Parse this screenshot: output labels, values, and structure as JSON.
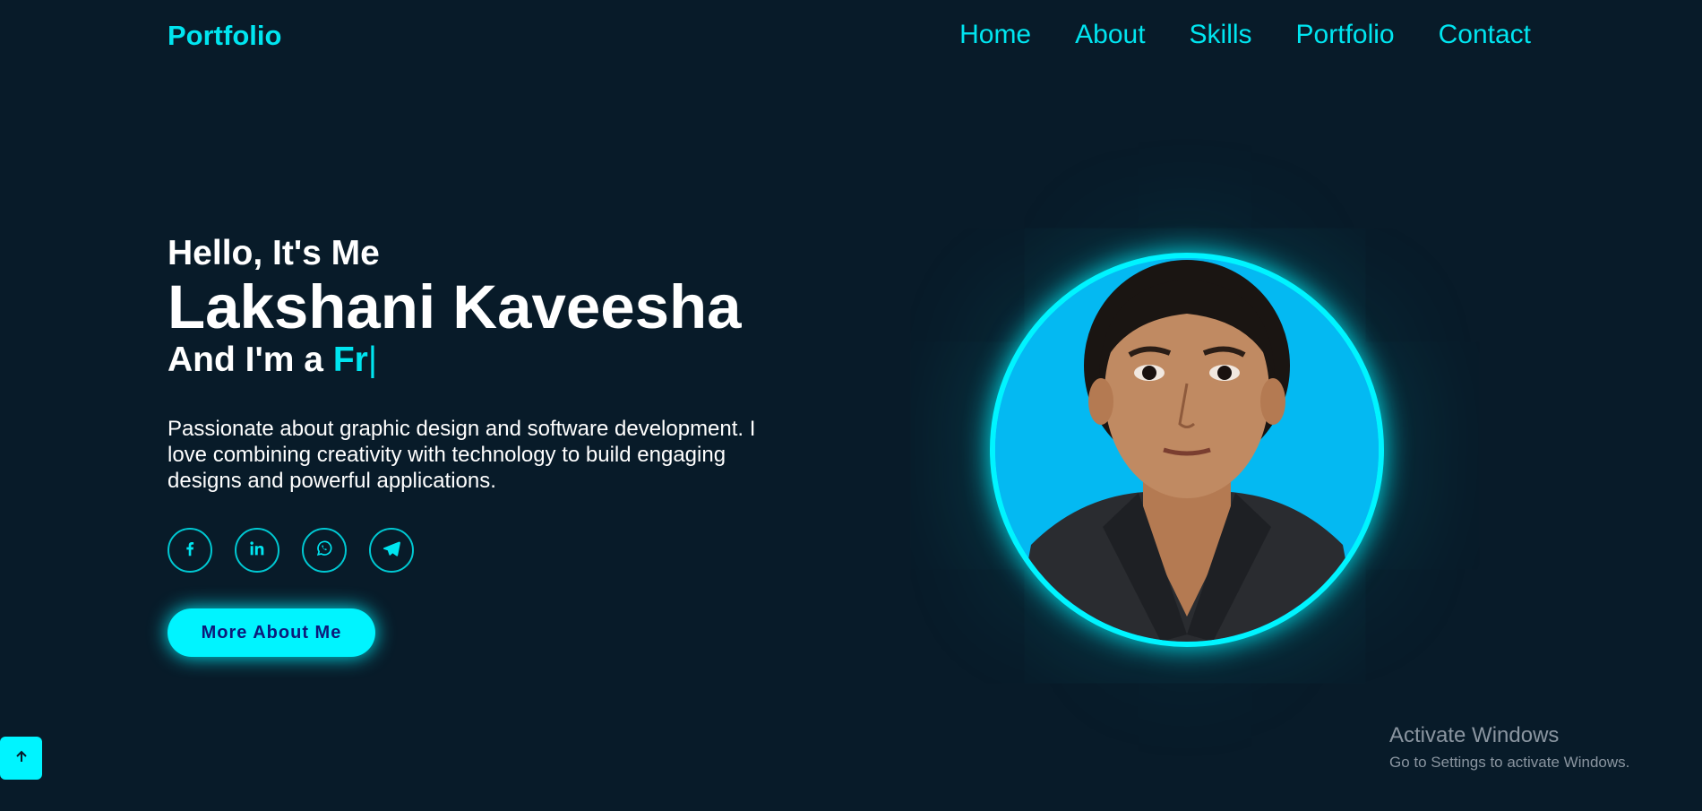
{
  "header": {
    "logo": "Portfolio",
    "nav": [
      "Home",
      "About",
      "Skills",
      "Portfolio",
      "Contact"
    ]
  },
  "hero": {
    "greeting": "Hello, It's Me",
    "name": "Lakshani Kaveesha",
    "role_prefix": "And I'm a",
    "role_typed": "Fr",
    "caret": "|",
    "description": "Passionate about graphic design and software development. I love combining creativity with technology to build engaging designs and powerful applications.",
    "socials": [
      "facebook-icon",
      "linkedin-icon",
      "whatsapp-icon",
      "telegram-icon"
    ],
    "cta_label": "More About Me"
  },
  "scroll_top": {
    "icon": "arrow-up-icon"
  },
  "watermark": {
    "title": "Activate Windows",
    "subtitle": "Go to Settings to activate Windows."
  },
  "colors": {
    "background": "#081b29",
    "accent": "#00e5f0",
    "cta_text": "#0d1a7a",
    "portrait_bg": "#04b9f2"
  }
}
